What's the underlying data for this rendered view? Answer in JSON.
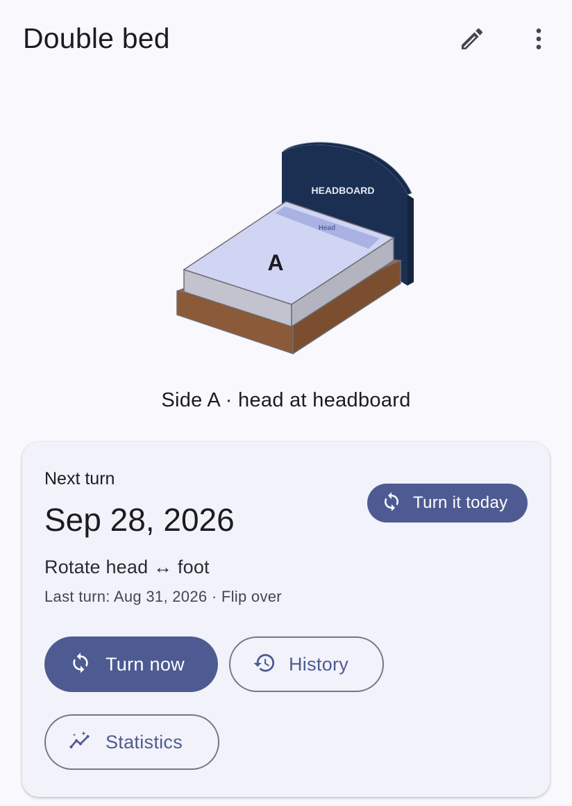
{
  "header": {
    "title": "Double bed",
    "edit_icon": "pencil-icon",
    "more_icon": "more-vert-icon"
  },
  "illustration": {
    "headboard_label": "HEADBOARD",
    "head_label": "Head",
    "side_letter": "A"
  },
  "status": {
    "side_text": "Side A · head at headboard"
  },
  "card": {
    "next_label": "Next turn",
    "next_date": "Sep 28, 2026",
    "rotate_text": "Rotate head ↔ foot",
    "last_turn": "Last turn: Aug 31, 2026 · Flip over",
    "turn_today_label": "Turn it today",
    "turn_now_label": "Turn now",
    "history_label": "History",
    "statistics_label": "Statistics"
  },
  "colors": {
    "primary": "#4e5b92",
    "headboard": "#1b2f52",
    "mattress_top": "#d0d5f3",
    "frame": "#8b5a39",
    "background": "#f8f8fd",
    "card": "#f2f2fa"
  }
}
